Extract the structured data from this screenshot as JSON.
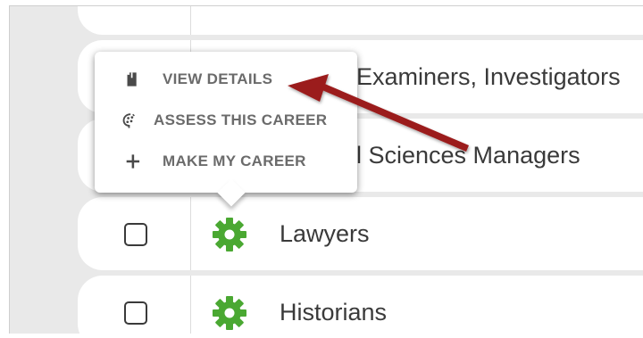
{
  "rows": [
    {
      "label": "Examiners, Investigators",
      "has_checkbox": false
    },
    {
      "label": "l Sciences Managers",
      "has_checkbox": false
    },
    {
      "label": "Lawyers",
      "has_checkbox": true
    },
    {
      "label": "Historians",
      "has_checkbox": true
    }
  ],
  "popup_menu": {
    "items": [
      {
        "label": "VIEW DETAILS",
        "icon": "document-icon"
      },
      {
        "label": "ASSESS THIS CAREER",
        "icon": "brain-icon"
      },
      {
        "label": "MAKE MY CAREER",
        "icon": "plus-icon"
      }
    ]
  },
  "colors": {
    "gear": "#4aa832",
    "arrow": "#9b1c1c",
    "menu_text": "#6b6b6b",
    "row_text": "#3a3a3a"
  }
}
